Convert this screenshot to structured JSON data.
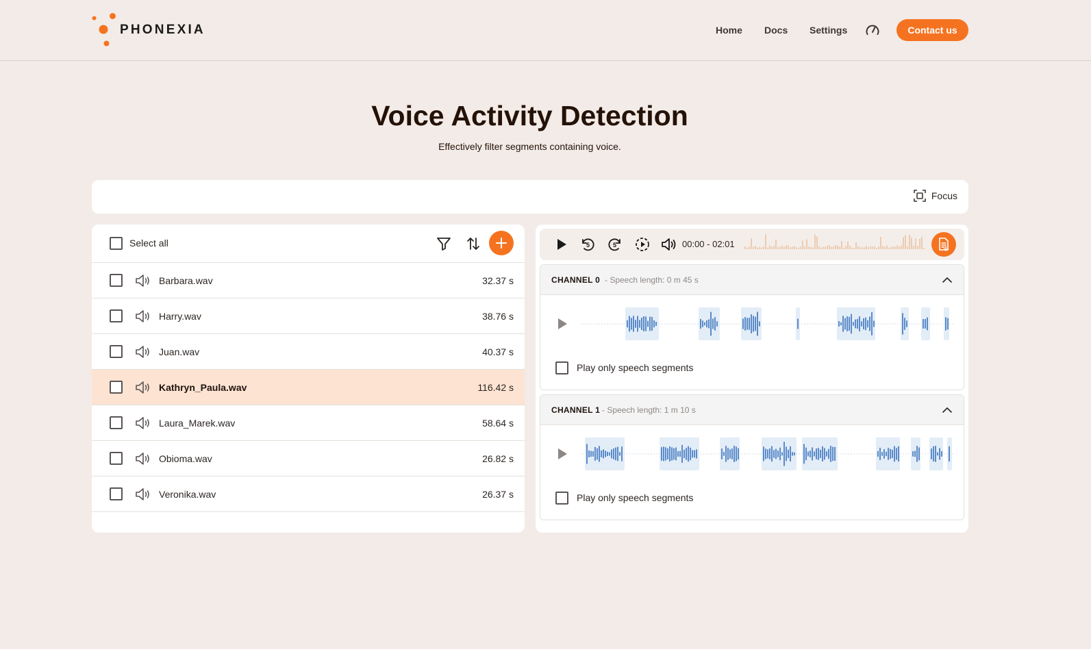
{
  "header": {
    "logo_text": "PHONEXIA",
    "nav": [
      "Home",
      "Docs",
      "Settings"
    ],
    "contact_label": "Contact us",
    "accent": "#f57320"
  },
  "hero": {
    "title": "Voice Activity Detection",
    "subtitle": "Effectively filter segments containing voice."
  },
  "toolbar": {
    "focus_label": "Focus"
  },
  "files": {
    "select_all_label": "Select all",
    "items": [
      {
        "name": "Barbara.wav",
        "duration": "32.37 s",
        "active": false
      },
      {
        "name": "Harry.wav",
        "duration": "38.76 s",
        "active": false
      },
      {
        "name": "Juan.wav",
        "duration": "40.37 s",
        "active": false
      },
      {
        "name": "Kathryn_Paula.wav",
        "duration": "116.42 s",
        "active": true
      },
      {
        "name": "Laura_Marek.wav",
        "duration": "58.64 s",
        "active": false
      },
      {
        "name": "Obioma.wav",
        "duration": "26.82 s",
        "active": false
      },
      {
        "name": "Veronika.wav",
        "duration": "26.37 s",
        "active": false
      }
    ]
  },
  "player": {
    "time": "00:00 - 02:01",
    "icons": [
      "play-icon",
      "rewind-5-icon",
      "forward-5-icon",
      "playback-speed-icon",
      "volume-icon",
      "report-icon"
    ]
  },
  "channels": [
    {
      "name": "CHANNEL 0",
      "speech_length": "- Speech length: 0 m 45 s",
      "play_only_label": "Play only speech segments"
    },
    {
      "name": "CHANNEL 1",
      "speech_length": "- Speech length: 1 m 10 s",
      "play_only_label": "Play only speech segments"
    }
  ]
}
